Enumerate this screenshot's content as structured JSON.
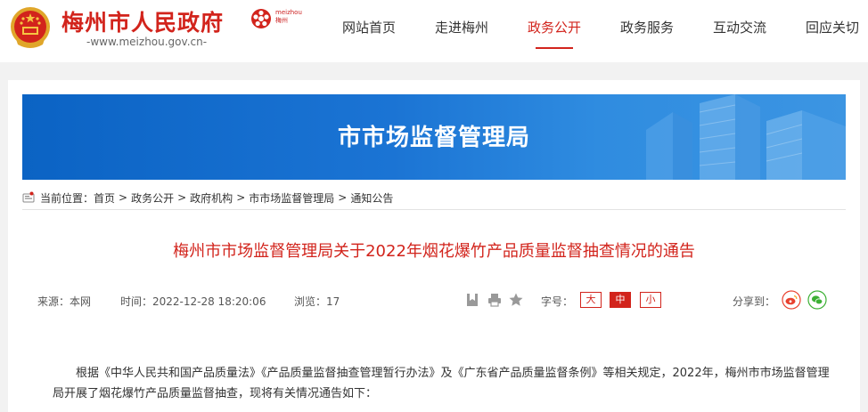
{
  "header": {
    "site_title": "梅州市人民政府",
    "site_url": "-www.meizhou.gov.cn-",
    "city_logo_text_top": "meizhou",
    "city_logo_text_bottom": "梅州"
  },
  "nav": {
    "items": [
      {
        "label": "网站首页"
      },
      {
        "label": "走进梅州"
      },
      {
        "label": "政务公开"
      },
      {
        "label": "政务服务"
      },
      {
        "label": "互动交流"
      },
      {
        "label": "回应关切"
      }
    ],
    "active_index": 2
  },
  "banner": {
    "title": "市市场监督管理局"
  },
  "breadcrumb": {
    "prefix": "当前位置：",
    "items": [
      "首页",
      "政务公开",
      "政府机构",
      "市市场监督管理局",
      "通知公告"
    ],
    "separator": ">"
  },
  "article": {
    "title": "梅州市市场监督管理局关于2022年烟花爆竹产品质量监督抽查情况的通告",
    "source": "来源：本网",
    "time": "时间：2022-12-28 18:20:06",
    "views": "浏览：17",
    "font_size_label": "字号：",
    "font_sizes": [
      "大",
      "中",
      "小"
    ],
    "font_size_active": "中",
    "share_label": "分享到：",
    "paragraph": "根据《中华人民共和国产品质量法》《产品质量监督抽查管理暂行办法》及《广东省产品质量监督条例》等相关规定，2022年，梅州市市场监督管理局开展了烟花爆竹产品质量监督抽查，现将有关情况通告如下："
  },
  "icons": {
    "emblem": "national-emblem-icon",
    "city_logo": "meizhou-logo-icon",
    "breadcrumb": "location-icon",
    "bookmark": "bookmark-icon",
    "print": "print-icon",
    "favorite": "star-icon",
    "weibo": "weibo-icon",
    "wechat": "wechat-icon"
  },
  "colors": {
    "brand_red": "#d2241c",
    "banner_blue": "#1b74d4",
    "weibo": "#e8412f",
    "wechat": "#3cb034"
  }
}
